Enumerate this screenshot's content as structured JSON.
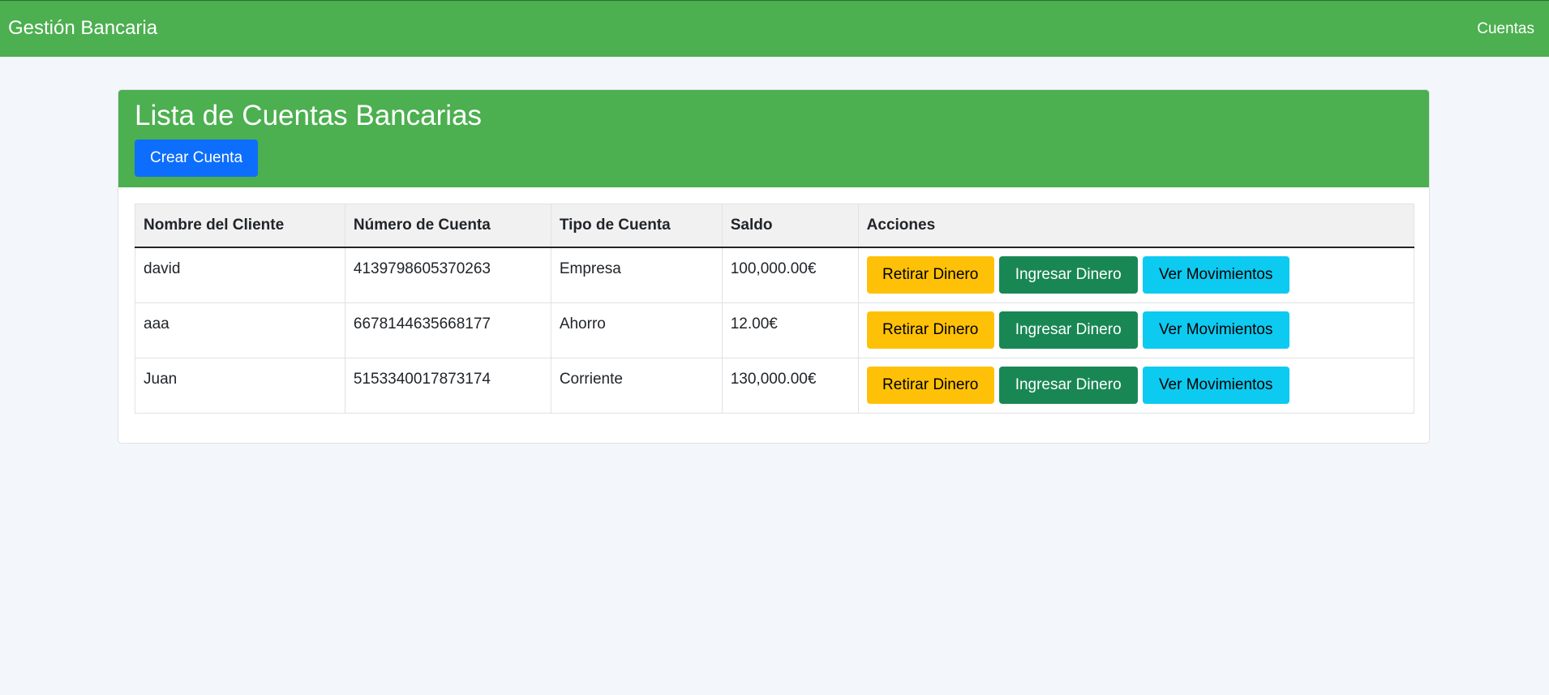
{
  "navbar": {
    "brand": "Gestión Bancaria",
    "link": "Cuentas"
  },
  "card": {
    "title": "Lista de Cuentas Bancarias",
    "create_button": "Crear Cuenta"
  },
  "table": {
    "headers": [
      "Nombre del Cliente",
      "Número de Cuenta",
      "Tipo de Cuenta",
      "Saldo",
      "Acciones"
    ],
    "rows": [
      {
        "cliente": "david",
        "numero": "4139798605370263",
        "tipo": "Empresa",
        "saldo": "100,000.00€"
      },
      {
        "cliente": "aaa",
        "numero": "6678144635668177",
        "tipo": "Ahorro",
        "saldo": "12.00€"
      },
      {
        "cliente": "Juan",
        "numero": "5153340017873174",
        "tipo": "Corriente",
        "saldo": "130,000.00€"
      }
    ],
    "actions": {
      "withdraw": "Retirar Dinero",
      "deposit": "Ingresar Dinero",
      "movements": "Ver Movimientos"
    }
  },
  "colors": {
    "header_green": "#4caf50",
    "primary": "#0d6efd",
    "warning": "#ffc107",
    "success": "#198754",
    "info": "#0dcaf0",
    "page_background": "#f3f6fa"
  }
}
